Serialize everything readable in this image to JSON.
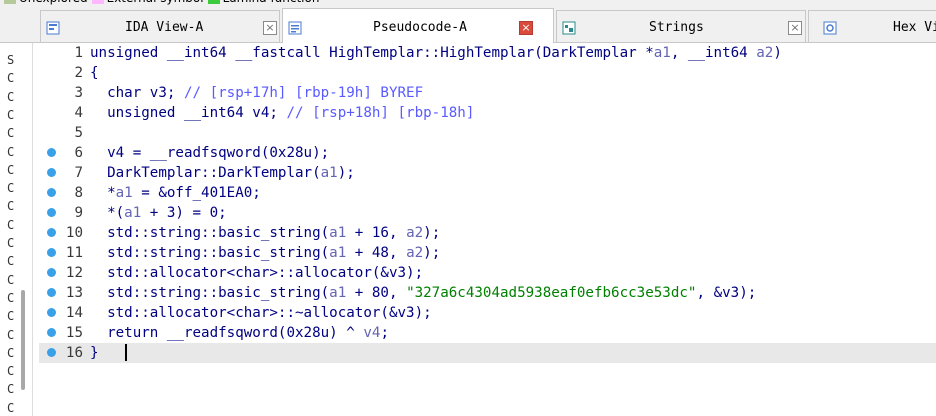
{
  "legend": {
    "items": [
      {
        "label": "Unexplored",
        "color": "#b5c99a"
      },
      {
        "label": "External symbol",
        "color": "#ffb8ff"
      },
      {
        "label": "Lumina function",
        "color": "#3ccb3c"
      }
    ]
  },
  "tabs": [
    {
      "label": "IDA View-A",
      "close": "×",
      "icon": "ida-view-icon"
    },
    {
      "label": "Pseudocode-A",
      "close": "×",
      "icon": "pseudocode-icon",
      "active": true
    },
    {
      "label": "Strings",
      "close": "×",
      "icon": "strings-icon"
    },
    {
      "label": "Hex Vi",
      "close": "",
      "icon": "hex-view-icon"
    }
  ],
  "left_strip": {
    "letters": [
      "S",
      "C",
      "C",
      "C",
      "C",
      "C",
      "C",
      "C",
      "C",
      "C",
      "C",
      "C",
      "C",
      "C",
      "C",
      "C",
      "C",
      "C",
      "C",
      "C"
    ]
  },
  "code": {
    "lines": [
      {
        "num": "1",
        "bp": false,
        "tokens": [
          {
            "t": "unsigned __int64 __fastcall HighTemplar::HighTemplar(DarkTemplar *",
            "c": "tx"
          },
          {
            "t": "a1",
            "c": "arg"
          },
          {
            "t": ", __int64 ",
            "c": "tx"
          },
          {
            "t": "a2",
            "c": "arg"
          },
          {
            "t": ")",
            "c": "tx"
          }
        ]
      },
      {
        "num": "2",
        "bp": false,
        "tokens": [
          {
            "t": "{",
            "c": "tx"
          }
        ]
      },
      {
        "num": "3",
        "bp": false,
        "tokens": [
          {
            "t": "  char v3; ",
            "c": "tx"
          },
          {
            "t": "// [rsp+17h] [rbp-19h] BYREF",
            "c": "cm"
          }
        ]
      },
      {
        "num": "4",
        "bp": false,
        "tokens": [
          {
            "t": "  unsigned __int64 v4; ",
            "c": "tx"
          },
          {
            "t": "// [rsp+18h] [rbp-18h]",
            "c": "cm"
          }
        ]
      },
      {
        "num": "5",
        "bp": false,
        "tokens": [
          {
            "t": "",
            "c": "tx"
          }
        ]
      },
      {
        "num": "6",
        "bp": true,
        "tokens": [
          {
            "t": "  v4 = __readfsqword(0x28u);",
            "c": "tx"
          }
        ]
      },
      {
        "num": "7",
        "bp": true,
        "tokens": [
          {
            "t": "  DarkTemplar::DarkTemplar(",
            "c": "tx"
          },
          {
            "t": "a1",
            "c": "arg"
          },
          {
            "t": ");",
            "c": "tx"
          }
        ]
      },
      {
        "num": "8",
        "bp": true,
        "tokens": [
          {
            "t": "  *",
            "c": "tx"
          },
          {
            "t": "a1",
            "c": "arg"
          },
          {
            "t": " = &off_401EA0;",
            "c": "tx"
          }
        ]
      },
      {
        "num": "9",
        "bp": true,
        "tokens": [
          {
            "t": "  *(",
            "c": "tx"
          },
          {
            "t": "a1",
            "c": "arg"
          },
          {
            "t": " + 3) = 0;",
            "c": "tx"
          }
        ]
      },
      {
        "num": "10",
        "bp": true,
        "tokens": [
          {
            "t": "  std::string::basic_string(",
            "c": "tx"
          },
          {
            "t": "a1",
            "c": "arg"
          },
          {
            "t": " + 16, ",
            "c": "tx"
          },
          {
            "t": "a2",
            "c": "arg"
          },
          {
            "t": ");",
            "c": "tx"
          }
        ]
      },
      {
        "num": "11",
        "bp": true,
        "tokens": [
          {
            "t": "  std::string::basic_string(",
            "c": "tx"
          },
          {
            "t": "a1",
            "c": "arg"
          },
          {
            "t": " + 48, ",
            "c": "tx"
          },
          {
            "t": "a2",
            "c": "arg"
          },
          {
            "t": ");",
            "c": "tx"
          }
        ]
      },
      {
        "num": "12",
        "bp": true,
        "tokens": [
          {
            "t": "  std::allocator<char>::allocator(&v3);",
            "c": "tx"
          }
        ]
      },
      {
        "num": "13",
        "bp": true,
        "tokens": [
          {
            "t": "  std::string::basic_string(",
            "c": "tx"
          },
          {
            "t": "a1",
            "c": "arg"
          },
          {
            "t": " + 80, ",
            "c": "tx"
          },
          {
            "t": "\"327a6c4304ad5938eaf0efb6cc3e53dc\"",
            "c": "str"
          },
          {
            "t": ", &v3);",
            "c": "tx"
          }
        ]
      },
      {
        "num": "14",
        "bp": true,
        "tokens": [
          {
            "t": "  std::allocator<char>::~allocator(&v3);",
            "c": "tx"
          }
        ]
      },
      {
        "num": "15",
        "bp": true,
        "tokens": [
          {
            "t": "  return __readfsqword(0x28u) ^ ",
            "c": "tx"
          },
          {
            "t": "v4",
            "c": "arg"
          },
          {
            "t": ";",
            "c": "tx"
          }
        ]
      },
      {
        "num": "16",
        "bp": true,
        "current": true,
        "tokens": [
          {
            "t": "}",
            "c": "tx"
          }
        ]
      }
    ]
  },
  "colors": {
    "breakpoint": "#3aa0e8",
    "active_tab_close": "#d94b3c",
    "string_literal": "#008000",
    "comment": "#5a5aff",
    "argument": "#6464b4",
    "identifier": "#000080"
  }
}
